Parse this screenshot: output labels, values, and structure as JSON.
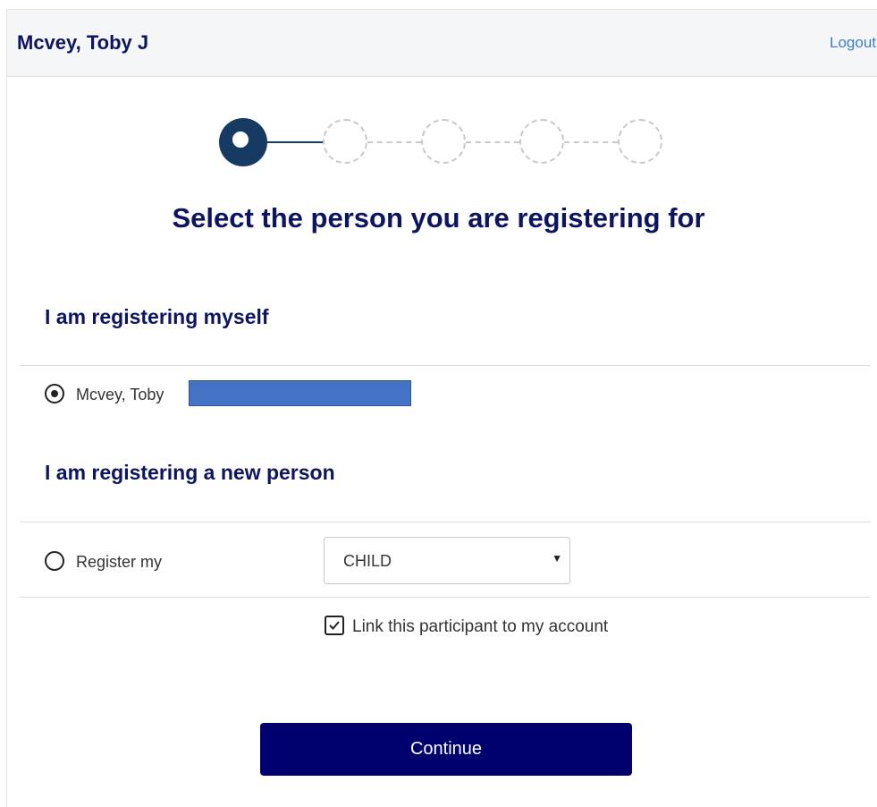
{
  "header": {
    "user_name": "Mcvey, Toby J",
    "logout_label": "Logout"
  },
  "stepper": {
    "total_steps": 5,
    "current_step": 1,
    "active_color": "#173a63",
    "inactive_color": "#c7c9cd"
  },
  "page_title": "Select the person you are registering for",
  "self_section": {
    "heading": "I am registering myself",
    "option_label": "Mcvey, Toby",
    "selected": true
  },
  "new_person_section": {
    "heading": "I am registering a new person",
    "option_label": "Register my",
    "selected": false,
    "relation_select_value": "CHILD"
  },
  "link_account": {
    "label": "Link this participant to my account",
    "checked": true
  },
  "continue_label": "Continue",
  "colors": {
    "primary": "#00006e",
    "heading": "#0d1561",
    "link": "#3a7ec8"
  }
}
